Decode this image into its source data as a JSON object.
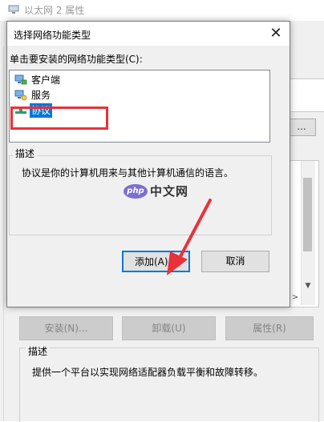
{
  "background_window": {
    "title": "以太网 2 属性",
    "more_button": "...",
    "buttons": {
      "install": "安装(N)...",
      "uninstall": "卸载(U)",
      "properties": "属性(R)"
    },
    "description": {
      "label": "描述",
      "text": "提供一个平台以实现网络适配器负载平衡和故障转移。"
    }
  },
  "dialog": {
    "title": "选择网络功能类型",
    "close_glyph": "✕",
    "prompt": "单击要安装的网络功能类型(C):",
    "types": [
      {
        "label": "客户端",
        "icon": "client-icon",
        "selected": false
      },
      {
        "label": "服务",
        "icon": "service-icon",
        "selected": false
      },
      {
        "label": "协议",
        "icon": "protocol-icon",
        "selected": true
      }
    ],
    "description": {
      "label": "描述",
      "text": "协议是你的计算机用来与其他计算机通信的语言。"
    },
    "buttons": {
      "add": "添加(A)...",
      "cancel": "取消"
    }
  },
  "watermark": {
    "logo": "php",
    "text": "中文网"
  },
  "colors": {
    "selection": "#0078d7",
    "highlight_box": "#e8313a",
    "arrow": "#e8313a",
    "default_button_border": "#0078d7"
  }
}
